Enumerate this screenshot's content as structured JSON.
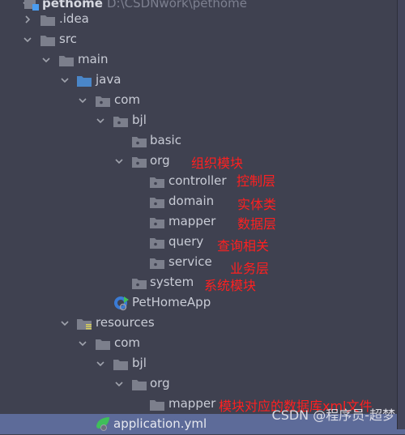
{
  "project": {
    "name": "pethome",
    "path": "D:\\CSDNwork\\pethome"
  },
  "tree": [
    {
      "label": ".idea",
      "expanded": false,
      "icon": "folder-icon"
    },
    {
      "label": "src",
      "expanded": true,
      "icon": "folder-icon"
    },
    {
      "label": "main",
      "expanded": true,
      "icon": "folder-icon"
    },
    {
      "label": "java",
      "expanded": true,
      "icon": "source-folder-icon"
    },
    {
      "label": "com",
      "expanded": true,
      "icon": "package-icon"
    },
    {
      "label": "bjl",
      "expanded": true,
      "icon": "package-icon"
    },
    {
      "label": "basic",
      "icon": "package-icon"
    },
    {
      "label": "org",
      "expanded": true,
      "icon": "package-icon"
    },
    {
      "label": "controller",
      "icon": "package-icon"
    },
    {
      "label": "domain",
      "icon": "package-icon"
    },
    {
      "label": "mapper",
      "icon": "package-icon"
    },
    {
      "label": "query",
      "icon": "package-icon"
    },
    {
      "label": "service",
      "icon": "package-icon"
    },
    {
      "label": "system",
      "icon": "package-icon"
    },
    {
      "label": "PetHomeApp",
      "icon": "spring-boot-app-icon"
    },
    {
      "label": "resources",
      "expanded": true,
      "icon": "resources-folder-icon"
    },
    {
      "label": "com",
      "expanded": true,
      "icon": "folder-icon"
    },
    {
      "label": "bjl",
      "expanded": true,
      "icon": "folder-icon"
    },
    {
      "label": "org",
      "expanded": true,
      "icon": "folder-icon"
    },
    {
      "label": "mapper",
      "icon": "folder-icon"
    },
    {
      "label": "application.yml",
      "icon": "spring-yml-icon",
      "selected": true
    }
  ],
  "annotations": {
    "org": "组织模块",
    "controller": "控制层",
    "domain": "实体类",
    "mapper": "数据层",
    "query": "查询相关",
    "service": "业务层",
    "system": "系统模块",
    "resources_mapper": "模块对应的数据库xml文件"
  },
  "watermark": "CSDN @程序员-超梦",
  "colors": {
    "background": "#3f4150",
    "selection": "#5d6b99",
    "annotation": "#ff2020",
    "folder": "#7c7f8c",
    "source_folder": "#4a86c8"
  }
}
